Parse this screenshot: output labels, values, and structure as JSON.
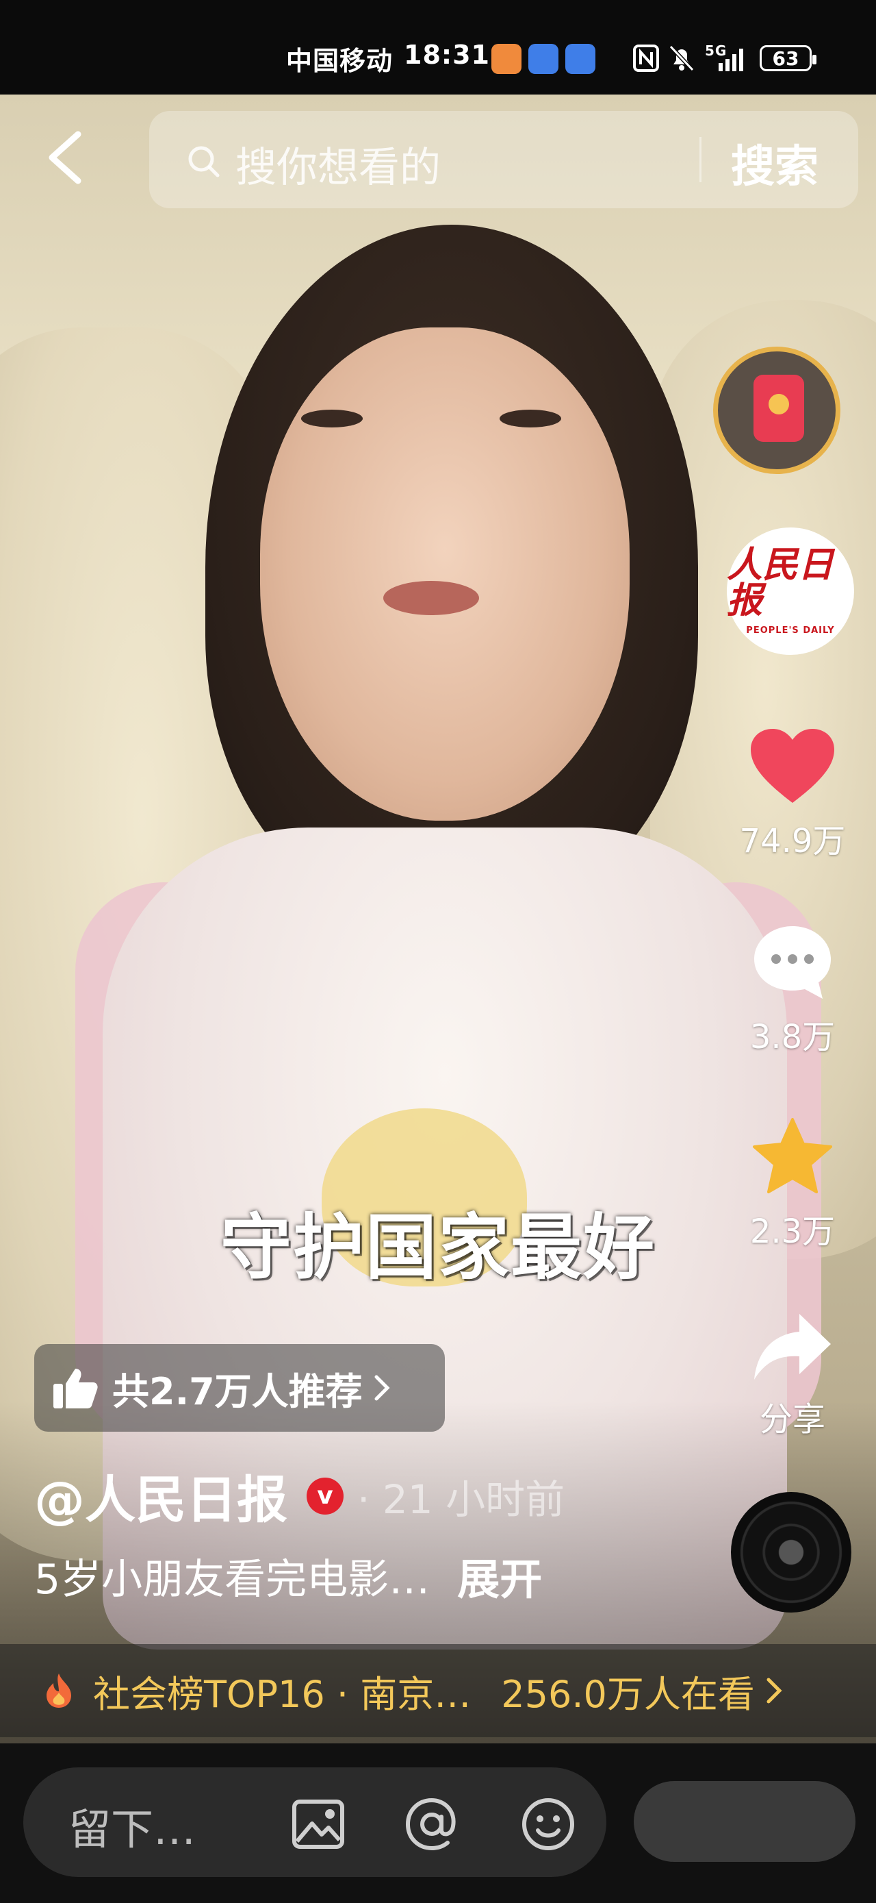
{
  "status_bar": {
    "carrier": "中国移动",
    "time": "18:31",
    "network": "5G",
    "battery": "63"
  },
  "search": {
    "placeholder": "搜你想看的",
    "button": "搜索"
  },
  "rail": {
    "likes": "74.9万",
    "comments": "3.8万",
    "favorites": "2.3万",
    "share": "分享",
    "avatar_cn": "人民日报",
    "avatar_en": "PEOPLE'S DAILY"
  },
  "video": {
    "subtitle": "守护国家最好"
  },
  "recommend": {
    "label": "共2.7万人推荐"
  },
  "post": {
    "author": "@人民日报",
    "verified_mark": "v",
    "time": "· 21 小时前",
    "description": "5岁小朋友看完电影…",
    "expand": "展开"
  },
  "hot": {
    "text": "社会榜TOP16 · 南京…",
    "viewers": "256.0万人在看"
  },
  "comment": {
    "placeholder": "留下…",
    "send_label": ""
  },
  "colors": {
    "like": "#f0465c",
    "star": "#f6b833",
    "hot": "#f3c85a",
    "verified": "#e3222e"
  }
}
